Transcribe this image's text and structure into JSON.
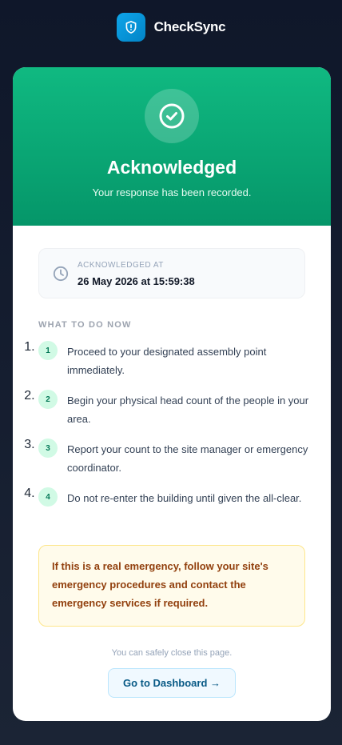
{
  "brand": {
    "name": "CheckSync",
    "logo_icon": "shield-alert-icon",
    "accent": "#0ea5e9"
  },
  "hero": {
    "icon": "check-circle-icon",
    "title": "Acknowledged",
    "subtitle": "Your response has been recorded.",
    "color": "#10b981"
  },
  "acknowledged": {
    "icon": "clock-icon",
    "label": "ACKNOWLEDGED AT",
    "value": "26 May 2026 at 15:59:38"
  },
  "instructions": {
    "title": "WHAT TO DO NOW",
    "steps": [
      {
        "number": "1",
        "text": "Proceed to your designated assembly point immediately."
      },
      {
        "number": "2",
        "text": "Begin your physical head count of the people in your area."
      },
      {
        "number": "3",
        "text": "Report your count to the site manager or emergency coordinator."
      },
      {
        "number": "4",
        "text": "Do not re-enter the building until given the all-clear."
      }
    ]
  },
  "warning": {
    "text": "If this is a real emergency, follow your site's emergency procedures and contact the emergency services if required."
  },
  "footer": {
    "note": "You can safely close this page.",
    "button_label": "Go to Dashboard →"
  }
}
